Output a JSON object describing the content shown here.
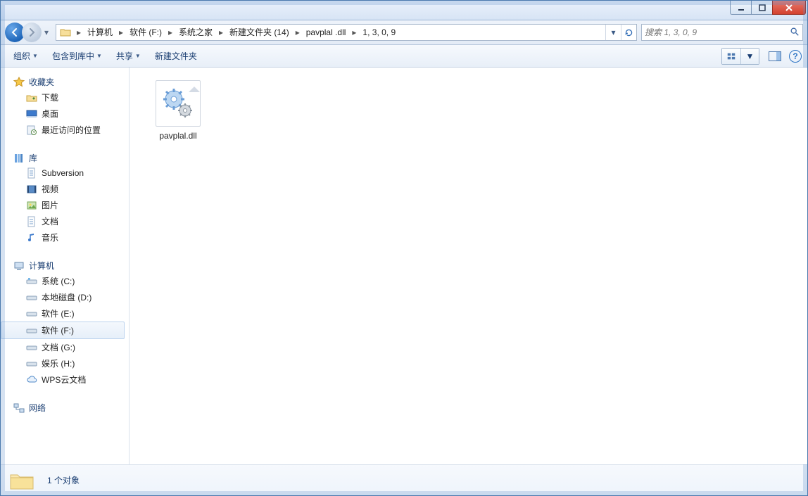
{
  "breadcrumb": {
    "items": [
      "计算机",
      "软件 (F:)",
      "系统之家",
      "新建文件夹 (14)",
      "pavplal .dll",
      "1, 3, 0, 9"
    ]
  },
  "search": {
    "placeholder": "搜索 1, 3, 0, 9"
  },
  "toolbar": {
    "organize": "组织",
    "include": "包含到库中",
    "share": "共享",
    "newfolder": "新建文件夹"
  },
  "sidebar": {
    "favorites": {
      "header": "收藏夹",
      "items": [
        "下载",
        "桌面",
        "最近访问的位置"
      ]
    },
    "libraries": {
      "header": "库",
      "items": [
        "Subversion",
        "视频",
        "图片",
        "文档",
        "音乐"
      ]
    },
    "computer": {
      "header": "计算机",
      "items": [
        "系统 (C:)",
        "本地磁盘 (D:)",
        "软件 (E:)",
        "软件 (F:)",
        "文档 (G:)",
        "娱乐 (H:)",
        "WPS云文档"
      ],
      "selectedIndex": 3
    },
    "network": {
      "header": "网络"
    }
  },
  "content": {
    "files": [
      {
        "name": "pavplal.dll"
      }
    ]
  },
  "statusbar": {
    "text": "1 个对象"
  }
}
